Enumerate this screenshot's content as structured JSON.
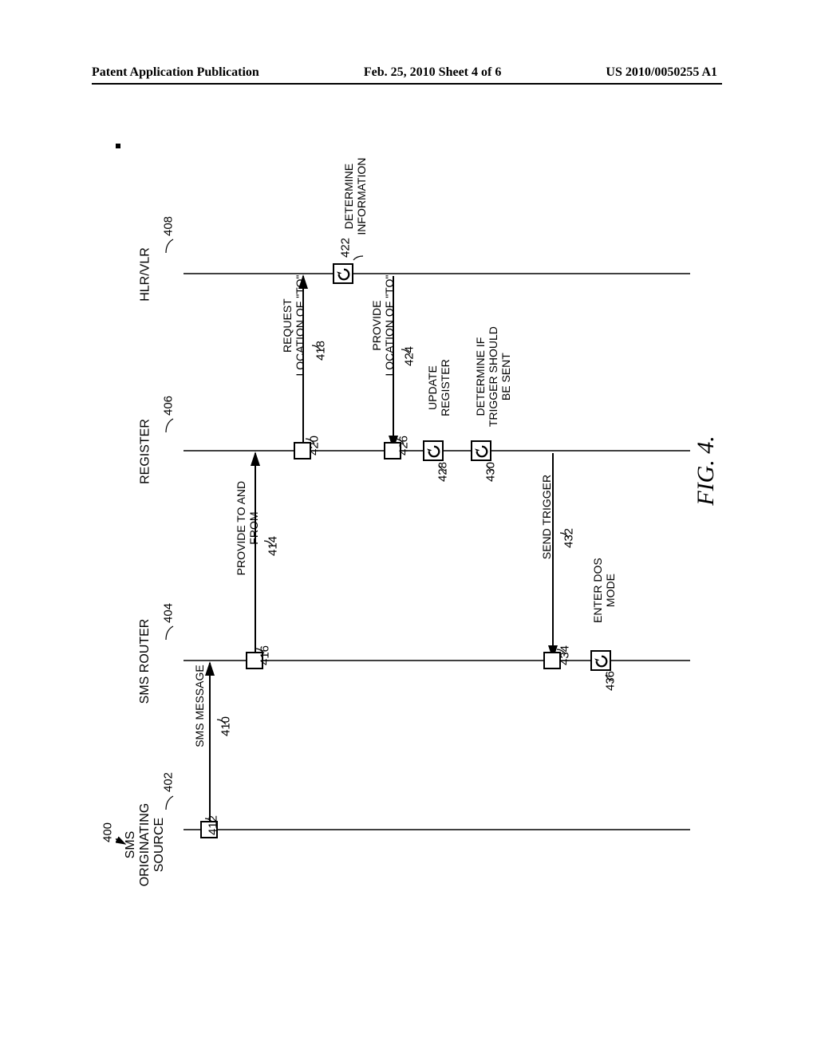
{
  "header": {
    "left": "Patent Application Publication",
    "center": "Feb. 25, 2010  Sheet 4 of 6",
    "right": "US 2010/0050255 A1"
  },
  "diagram_ref": "400",
  "participants": {
    "p402": {
      "label": "SMS\nORIGINATING\nSOURCE",
      "ref": "402"
    },
    "p404": {
      "label": "SMS ROUTER",
      "ref": "404"
    },
    "p406": {
      "label": "REGISTER",
      "ref": "406"
    },
    "p408": {
      "label": "HLR/VLR",
      "ref": "408"
    }
  },
  "messages": {
    "m410": {
      "label": "SMS MESSAGE",
      "ref": "410"
    },
    "m412": {
      "ref": "412"
    },
    "m414": {
      "label": "PROVIDE TO AND\nFROM",
      "ref": "414"
    },
    "m416": {
      "ref": "416"
    },
    "m418": {
      "label": "REQUEST\nLOCATION OF \"TO\"",
      "ref": "418"
    },
    "m420": {
      "ref": "420"
    },
    "m422": {
      "label": "DETERMINE\nINFORMATION",
      "ref": "422"
    },
    "m424": {
      "label": "PROVIDE\nLOCATION OF \"TO\"",
      "ref": "424"
    },
    "m426": {
      "ref": "426"
    },
    "m428": {
      "label": "UPDATE\nREGISTER",
      "ref": "428"
    },
    "m430": {
      "label": "DETERMINE IF\nTRIGGER SHOULD\nBE SENT",
      "ref": "430"
    },
    "m432": {
      "label": "SEND TRIGGER",
      "ref": "432"
    },
    "m434": {
      "ref": "434"
    },
    "m436": {
      "label": "ENTER DOS\nMODE",
      "ref": "436"
    }
  },
  "figure_caption": "FIG. 4."
}
